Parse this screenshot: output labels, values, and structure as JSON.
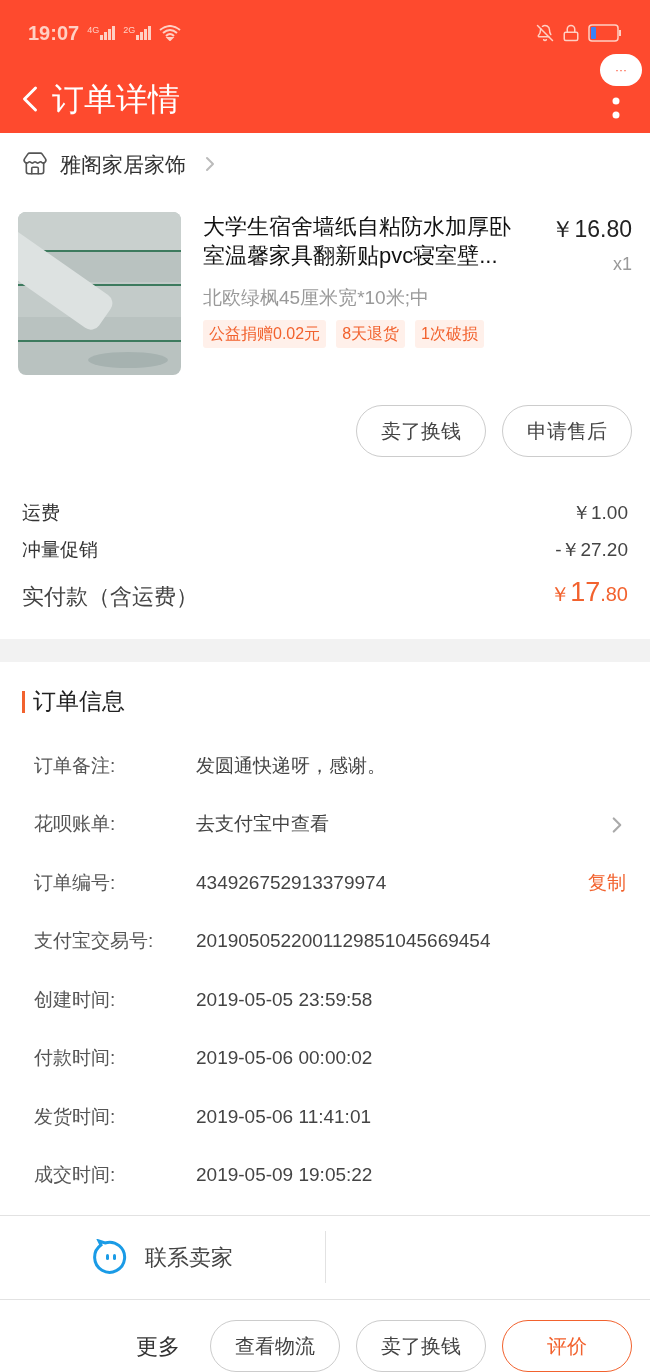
{
  "status_bar": {
    "time": "19:07",
    "network_labels": [
      "4G",
      "2G"
    ]
  },
  "header": {
    "title": "订单详情",
    "more_bubble": "···"
  },
  "shop": {
    "name": "雅阁家居家饰"
  },
  "product": {
    "title": "大学生宿舍墙纸自粘防水加厚卧室温馨家具翻新贴pvc寝室壁...",
    "price": "￥16.80",
    "quantity": "x1",
    "sku": "北欧绿枫45厘米宽*10米;中",
    "tags": [
      "公益捐赠0.02元",
      "8天退货",
      "1次破损"
    ]
  },
  "item_actions": [
    "卖了换钱",
    "申请售后"
  ],
  "fees": [
    {
      "label": "运费",
      "value": "￥1.00"
    },
    {
      "label": "冲量促销",
      "value": "-￥27.20"
    }
  ],
  "total": {
    "label": "实付款（含运费）",
    "symbol": "￥",
    "main": "17",
    "fraction": ".80"
  },
  "order_info": {
    "title": "订单信息",
    "rows": [
      {
        "label": "订单备注:",
        "value": "发圆通快递呀，感谢。",
        "chevron": false
      },
      {
        "label": "花呗账单:",
        "value": "去支付宝中查看",
        "chevron": true
      },
      {
        "label": "订单编号:",
        "value": "434926752913379974",
        "action": "复制",
        "chevron": false
      },
      {
        "label": "支付宝交易号:",
        "value": "2019050522001129851045669454",
        "chevron": false
      },
      {
        "label": "创建时间:",
        "value": "2019-05-05 23:59:58",
        "chevron": false
      },
      {
        "label": "付款时间:",
        "value": "2019-05-06 00:00:02",
        "chevron": false
      },
      {
        "label": "发货时间:",
        "value": "2019-05-06 11:41:01",
        "chevron": false
      },
      {
        "label": "成交时间:",
        "value": "2019-05-09 19:05:22",
        "chevron": false
      }
    ]
  },
  "contact": {
    "label": "联系卖家"
  },
  "footer": {
    "more": "更多",
    "buttons": [
      {
        "label": "查看物流",
        "kind": "outline"
      },
      {
        "label": "卖了换钱",
        "kind": "outline"
      },
      {
        "label": "评价",
        "kind": "primary"
      }
    ]
  }
}
